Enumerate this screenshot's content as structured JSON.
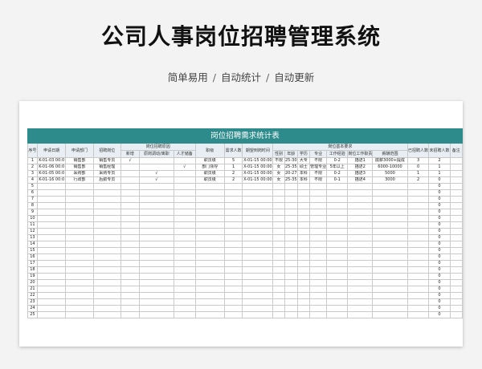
{
  "page": {
    "title": "公司人事岗位招聘管理系统",
    "subtitle_parts": [
      "简单易用",
      "自动统计",
      "自动更新"
    ],
    "separator": "/"
  },
  "table": {
    "title": "岗位招聘需求统计表",
    "accent_color": "#2e8b8b",
    "header_color": "#e8eef3",
    "headers": {
      "seq": "序号",
      "apply_date": "申请日期",
      "dept": "申请部门",
      "position": "招聘岗位",
      "reason_group": "岗位招聘原因",
      "reason_new": "新增",
      "reason_transfer": "原岗调动/离职",
      "reason_reserve": "人才储备",
      "rank": "职级",
      "count": "需求人数",
      "arrival": "期望到岗时间",
      "basic_group": "岗位基本要求",
      "gender": "性别",
      "age": "年龄",
      "education": "学历",
      "major": "专业",
      "experience": "工作经验",
      "duties": "岗位工作职责",
      "salary": "薪酬范围",
      "hired": "已招聘人数",
      "pending": "未招聘人数",
      "remarks": "备注"
    },
    "rows": [
      {
        "seq": "1",
        "date": "K-01-03 00:0",
        "dept": "销售部",
        "pos": "销售专员",
        "new": "√",
        "transfer": "",
        "reserve": "",
        "rank": "职员级",
        "count": "5",
        "arrival": "X-01-15 00:00",
        "gender": "不限",
        "age": "25-30",
        "edu": "大专",
        "major": "不限",
        "exp": "0-2",
        "duties": "描述1",
        "salary": "底薪3000+提成",
        "hired": "3",
        "pending": "2",
        "remarks": ""
      },
      {
        "seq": "2",
        "date": "K-01-06 00:0",
        "dept": "销售部",
        "pos": "销售经理",
        "new": "",
        "transfer": "",
        "reserve": "√",
        "rank": "部门领导",
        "count": "1",
        "arrival": "X-01-15 00:00",
        "gender": "女",
        "age": "25-35",
        "edu": "硕士",
        "major": "管理专业",
        "exp": "5年以上",
        "duties": "描述2",
        "salary": "6000-10000",
        "hired": "0",
        "pending": "1",
        "remarks": ""
      },
      {
        "seq": "3",
        "date": "K-01-05 00:0",
        "dept": "采购部",
        "pos": "采购专员",
        "new": "",
        "transfer": "√",
        "reserve": "",
        "rank": "职员级",
        "count": "2",
        "arrival": "X-01-15 00:00",
        "gender": "女",
        "age": "20-27",
        "edu": "本科",
        "major": "不限",
        "exp": "0-2",
        "duties": "描述3",
        "salary": "5000",
        "hired": "1",
        "pending": "1",
        "remarks": ""
      },
      {
        "seq": "4",
        "date": "K-01-16 00:0",
        "dept": "行政部",
        "pos": "后勤专员",
        "new": "",
        "transfer": "√",
        "reserve": "",
        "rank": "职员级",
        "count": "2",
        "arrival": "X-01-15 00:00",
        "gender": "女",
        "age": "25-35",
        "edu": "本科",
        "major": "不限",
        "exp": "0-1",
        "duties": "描述4",
        "salary": "3000",
        "hired": "2",
        "pending": "0",
        "remarks": ""
      }
    ],
    "empty_row_numbers": [
      "5",
      "6",
      "7",
      "8",
      "9",
      "10",
      "11",
      "12",
      "13",
      "14",
      "15",
      "16",
      "17",
      "18",
      "19",
      "20",
      "21",
      "22",
      "23",
      "24",
      "25"
    ],
    "empty_pending_value": "0"
  }
}
